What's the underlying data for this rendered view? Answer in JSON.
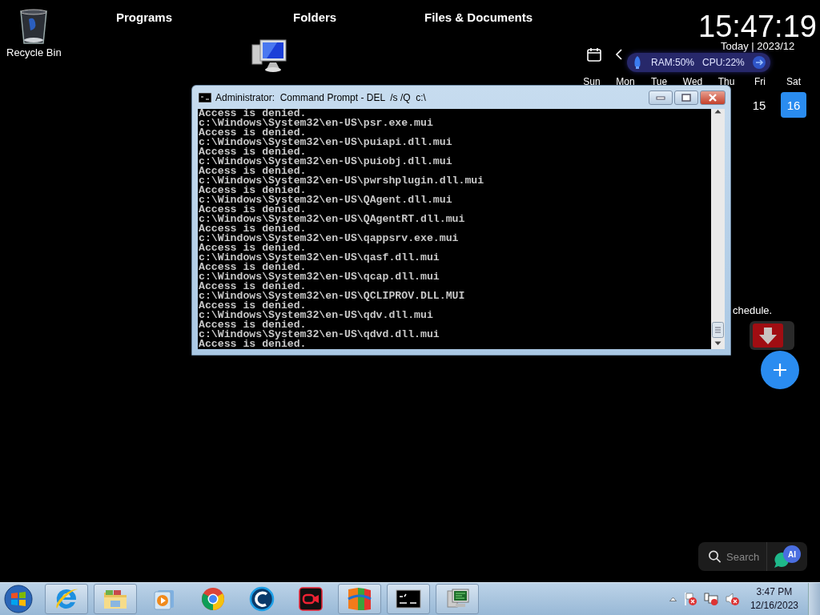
{
  "desktop_icons": [
    {
      "kind": "recycle-bin",
      "label": "Recycle Bin"
    },
    {
      "kind": "computer"
    }
  ],
  "headings": [
    "Programs",
    "Folders",
    "Files & Documents"
  ],
  "clock": {
    "time": "15:47:19"
  },
  "calendar": {
    "header": "Today | 2023/12",
    "weekdays": [
      "Sun",
      "Mon",
      "Tue",
      "Wed",
      "Thu",
      "Fri",
      "Sat"
    ],
    "days": [
      {
        "label": "15",
        "selected": false
      },
      {
        "label": "16",
        "selected": true
      }
    ]
  },
  "system_monitor": {
    "ram": "RAM:50%",
    "cpu": "CPU:22%"
  },
  "schedule_text": "chedule.",
  "search": {
    "placeholder": "Search"
  },
  "assistant_badge": "AI",
  "console_window": {
    "title": "Administrator:  Command Prompt - DEL  /s /Q  c:\\",
    "lines": [
      "Access is denied.",
      "c:\\Windows\\System32\\en-US\\psr.exe.mui",
      "Access is denied.",
      "c:\\Windows\\System32\\en-US\\puiapi.dll.mui",
      "Access is denied.",
      "c:\\Windows\\System32\\en-US\\puiobj.dll.mui",
      "Access is denied.",
      "c:\\Windows\\System32\\en-US\\pwrshplugin.dll.mui",
      "Access is denied.",
      "c:\\Windows\\System32\\en-US\\QAgent.dll.mui",
      "Access is denied.",
      "c:\\Windows\\System32\\en-US\\QAgentRT.dll.mui",
      "Access is denied.",
      "c:\\Windows\\System32\\en-US\\qappsrv.exe.mui",
      "Access is denied.",
      "c:\\Windows\\System32\\en-US\\qasf.dll.mui",
      "Access is denied.",
      "c:\\Windows\\System32\\en-US\\qcap.dll.mui",
      "Access is denied.",
      "c:\\Windows\\System32\\en-US\\QCLIPROV.DLL.MUI",
      "Access is denied.",
      "c:\\Windows\\System32\\en-US\\qdv.dll.mui",
      "Access is denied.",
      "c:\\Windows\\System32\\en-US\\qdvd.dll.mui",
      "Access is denied."
    ]
  },
  "taskbar": {
    "apps": [
      {
        "kind": "ie",
        "running": true
      },
      {
        "kind": "folder",
        "running": true
      },
      {
        "kind": "media",
        "running": false
      },
      {
        "kind": "chrome",
        "running": false
      },
      {
        "kind": "cleaner",
        "running": false
      },
      {
        "kind": "recorder",
        "running": false
      },
      {
        "kind": "avg",
        "running": true
      },
      {
        "kind": "console",
        "running": true
      },
      {
        "kind": "network",
        "running": true
      }
    ],
    "time": "3:47 PM",
    "date": "12/16/2023"
  }
}
